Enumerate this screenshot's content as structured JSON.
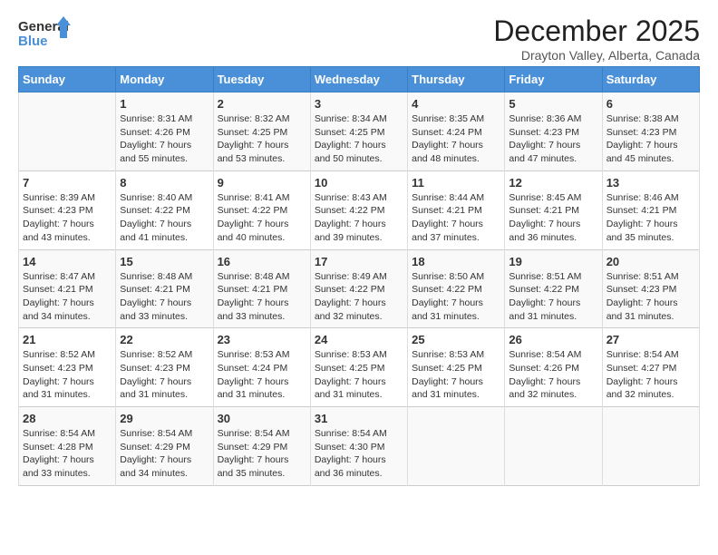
{
  "header": {
    "logo_line1": "General",
    "logo_line2": "Blue",
    "month": "December 2025",
    "location": "Drayton Valley, Alberta, Canada"
  },
  "days_of_week": [
    "Sunday",
    "Monday",
    "Tuesday",
    "Wednesday",
    "Thursday",
    "Friday",
    "Saturday"
  ],
  "weeks": [
    [
      {
        "day": "",
        "info": ""
      },
      {
        "day": "1",
        "info": "Sunrise: 8:31 AM\nSunset: 4:26 PM\nDaylight: 7 hours\nand 55 minutes."
      },
      {
        "day": "2",
        "info": "Sunrise: 8:32 AM\nSunset: 4:25 PM\nDaylight: 7 hours\nand 53 minutes."
      },
      {
        "day": "3",
        "info": "Sunrise: 8:34 AM\nSunset: 4:25 PM\nDaylight: 7 hours\nand 50 minutes."
      },
      {
        "day": "4",
        "info": "Sunrise: 8:35 AM\nSunset: 4:24 PM\nDaylight: 7 hours\nand 48 minutes."
      },
      {
        "day": "5",
        "info": "Sunrise: 8:36 AM\nSunset: 4:23 PM\nDaylight: 7 hours\nand 47 minutes."
      },
      {
        "day": "6",
        "info": "Sunrise: 8:38 AM\nSunset: 4:23 PM\nDaylight: 7 hours\nand 45 minutes."
      }
    ],
    [
      {
        "day": "7",
        "info": "Sunrise: 8:39 AM\nSunset: 4:23 PM\nDaylight: 7 hours\nand 43 minutes."
      },
      {
        "day": "8",
        "info": "Sunrise: 8:40 AM\nSunset: 4:22 PM\nDaylight: 7 hours\nand 41 minutes."
      },
      {
        "day": "9",
        "info": "Sunrise: 8:41 AM\nSunset: 4:22 PM\nDaylight: 7 hours\nand 40 minutes."
      },
      {
        "day": "10",
        "info": "Sunrise: 8:43 AM\nSunset: 4:22 PM\nDaylight: 7 hours\nand 39 minutes."
      },
      {
        "day": "11",
        "info": "Sunrise: 8:44 AM\nSunset: 4:21 PM\nDaylight: 7 hours\nand 37 minutes."
      },
      {
        "day": "12",
        "info": "Sunrise: 8:45 AM\nSunset: 4:21 PM\nDaylight: 7 hours\nand 36 minutes."
      },
      {
        "day": "13",
        "info": "Sunrise: 8:46 AM\nSunset: 4:21 PM\nDaylight: 7 hours\nand 35 minutes."
      }
    ],
    [
      {
        "day": "14",
        "info": "Sunrise: 8:47 AM\nSunset: 4:21 PM\nDaylight: 7 hours\nand 34 minutes."
      },
      {
        "day": "15",
        "info": "Sunrise: 8:48 AM\nSunset: 4:21 PM\nDaylight: 7 hours\nand 33 minutes."
      },
      {
        "day": "16",
        "info": "Sunrise: 8:48 AM\nSunset: 4:21 PM\nDaylight: 7 hours\nand 33 minutes."
      },
      {
        "day": "17",
        "info": "Sunrise: 8:49 AM\nSunset: 4:22 PM\nDaylight: 7 hours\nand 32 minutes."
      },
      {
        "day": "18",
        "info": "Sunrise: 8:50 AM\nSunset: 4:22 PM\nDaylight: 7 hours\nand 31 minutes."
      },
      {
        "day": "19",
        "info": "Sunrise: 8:51 AM\nSunset: 4:22 PM\nDaylight: 7 hours\nand 31 minutes."
      },
      {
        "day": "20",
        "info": "Sunrise: 8:51 AM\nSunset: 4:23 PM\nDaylight: 7 hours\nand 31 minutes."
      }
    ],
    [
      {
        "day": "21",
        "info": "Sunrise: 8:52 AM\nSunset: 4:23 PM\nDaylight: 7 hours\nand 31 minutes."
      },
      {
        "day": "22",
        "info": "Sunrise: 8:52 AM\nSunset: 4:23 PM\nDaylight: 7 hours\nand 31 minutes."
      },
      {
        "day": "23",
        "info": "Sunrise: 8:53 AM\nSunset: 4:24 PM\nDaylight: 7 hours\nand 31 minutes."
      },
      {
        "day": "24",
        "info": "Sunrise: 8:53 AM\nSunset: 4:25 PM\nDaylight: 7 hours\nand 31 minutes."
      },
      {
        "day": "25",
        "info": "Sunrise: 8:53 AM\nSunset: 4:25 PM\nDaylight: 7 hours\nand 31 minutes."
      },
      {
        "day": "26",
        "info": "Sunrise: 8:54 AM\nSunset: 4:26 PM\nDaylight: 7 hours\nand 32 minutes."
      },
      {
        "day": "27",
        "info": "Sunrise: 8:54 AM\nSunset: 4:27 PM\nDaylight: 7 hours\nand 32 minutes."
      }
    ],
    [
      {
        "day": "28",
        "info": "Sunrise: 8:54 AM\nSunset: 4:28 PM\nDaylight: 7 hours\nand 33 minutes."
      },
      {
        "day": "29",
        "info": "Sunrise: 8:54 AM\nSunset: 4:29 PM\nDaylight: 7 hours\nand 34 minutes."
      },
      {
        "day": "30",
        "info": "Sunrise: 8:54 AM\nSunset: 4:29 PM\nDaylight: 7 hours\nand 35 minutes."
      },
      {
        "day": "31",
        "info": "Sunrise: 8:54 AM\nSunset: 4:30 PM\nDaylight: 7 hours\nand 36 minutes."
      },
      {
        "day": "",
        "info": ""
      },
      {
        "day": "",
        "info": ""
      },
      {
        "day": "",
        "info": ""
      }
    ]
  ]
}
